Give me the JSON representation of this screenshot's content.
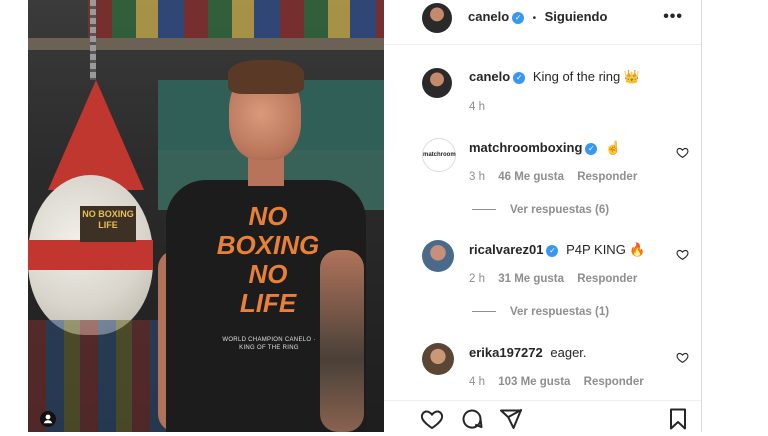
{
  "photo": {
    "bag_label": "NO BOXING LIFE",
    "shirt_lines": [
      "NO",
      "BOXING",
      "NO",
      "LIFE"
    ],
    "shirt_sub": "WORLD CHAMPION CANELO · KING OF THE RING"
  },
  "header": {
    "username": "canelo",
    "separator": "•",
    "follow_label": "Siguiendo",
    "more_label": "•••"
  },
  "caption": {
    "username": "canelo",
    "text": "King of the ring 👑",
    "time": "4 h"
  },
  "comments": [
    {
      "username": "matchroomboxing",
      "avatar_text": "matchroom",
      "text": "☝️",
      "time": "3 h",
      "likes": "46 Me gusta",
      "reply_label": "Responder",
      "view_replies": "Ver respuestas (6)"
    },
    {
      "username": "ricalvarez01",
      "text": "P4P KING 🔥",
      "time": "2 h",
      "likes": "31 Me gusta",
      "reply_label": "Responder",
      "view_replies": "Ver respuestas (1)"
    },
    {
      "username": "erika197272",
      "text": "eager.",
      "time": "4 h",
      "likes": "103 Me gusta",
      "reply_label": "Responder"
    }
  ],
  "icons": {
    "like": "heart-icon",
    "comment": "comment-icon",
    "share": "share-icon",
    "save": "bookmark-icon",
    "user_tag": "user-tag-icon",
    "verified": "verified-badge-icon"
  },
  "colors": {
    "verified": "#3897f0",
    "meta_text": "#8e8e8e",
    "shirt_print": "#e9803a"
  }
}
